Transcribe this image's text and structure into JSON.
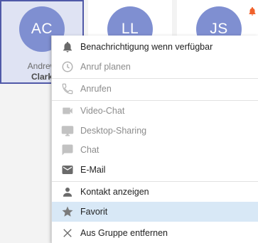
{
  "contacts": [
    {
      "initials": "AC",
      "first_name": "Andrew",
      "last_name": "Clark"
    },
    {
      "initials": "LL"
    },
    {
      "initials": "JS"
    }
  ],
  "menu": {
    "items": [
      {
        "label": "Benachrichtigung wenn verfügbar",
        "icon": "bell-icon",
        "enabled": true
      },
      {
        "label": "Anruf planen",
        "icon": "clock-icon",
        "enabled": false
      },
      {
        "label": "Anrufen",
        "icon": "phone-icon",
        "enabled": false
      },
      {
        "label": "Video-Chat",
        "icon": "video-camera-icon",
        "enabled": false
      },
      {
        "label": "Desktop-Sharing",
        "icon": "monitor-icon",
        "enabled": false
      },
      {
        "label": "Chat",
        "icon": "chat-bubble-icon",
        "enabled": false
      },
      {
        "label": "E-Mail",
        "icon": "envelope-icon",
        "enabled": true
      },
      {
        "label": "Kontakt anzeigen",
        "icon": "person-icon",
        "enabled": true
      },
      {
        "label": "Favorit",
        "icon": "star-icon",
        "enabled": true,
        "highlighted": true
      },
      {
        "label": "Aus Gruppe entfernen",
        "icon": "close-icon",
        "enabled": true
      }
    ]
  },
  "colors": {
    "avatar": "#7f8fd1",
    "selection_border": "#5059a8",
    "menu_highlight": "#d8e8f6",
    "notification_badge": "#f0622c"
  }
}
